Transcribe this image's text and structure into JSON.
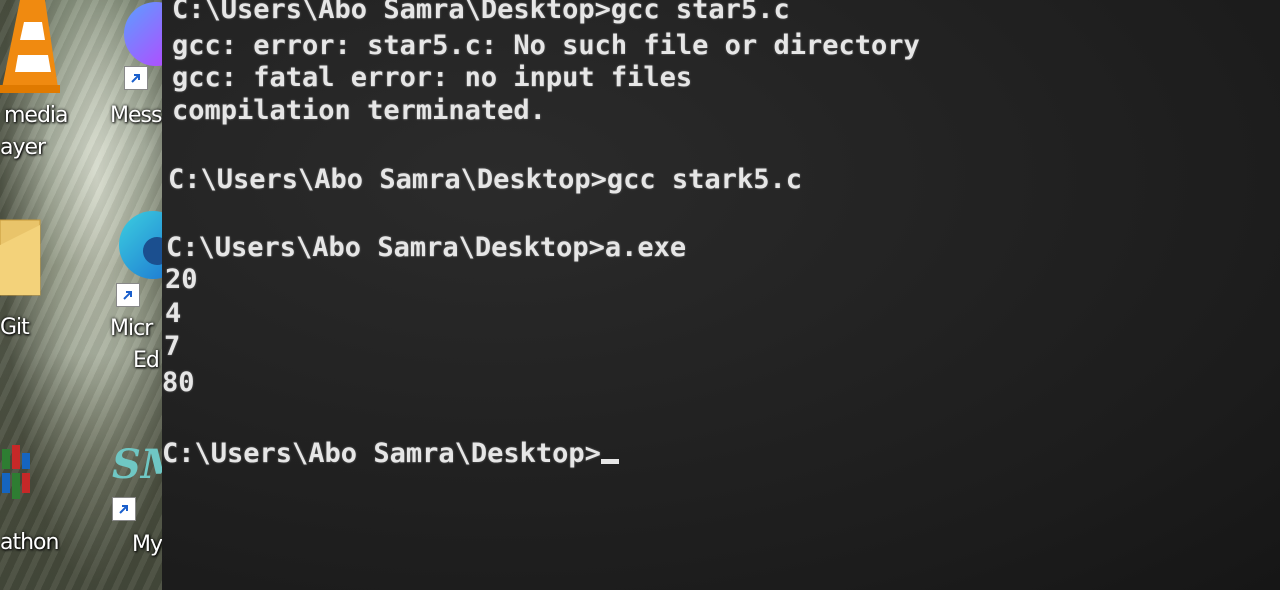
{
  "desktop": {
    "icons": [
      {
        "name": "vlc-media-player-icon",
        "label_line1": "media",
        "label_line2": "ayer"
      },
      {
        "name": "messenger-icon",
        "label_line1": "Mess"
      },
      {
        "name": "git-icon",
        "label_line1": "Git"
      },
      {
        "name": "microsoft-edge-icon",
        "label_line1": "Micr",
        "label_line2": "Ed"
      },
      {
        "name": "python-icon",
        "label_line1": "athon"
      },
      {
        "name": "my-app-icon",
        "label_line1": "My"
      }
    ]
  },
  "terminal": {
    "lines": [
      "C:\\Users\\Abo Samra\\Desktop>gcc star5.c",
      "gcc: error: star5.c: No such file or directory",
      "gcc: fatal error: no input files",
      "compilation terminated.",
      "C:\\Users\\Abo Samra\\Desktop>gcc stark5.c",
      "C:\\Users\\Abo Samra\\Desktop>a.exe",
      "20",
      "4",
      "7",
      "80",
      "C:\\Users\\Abo Samra\\Desktop>"
    ]
  }
}
